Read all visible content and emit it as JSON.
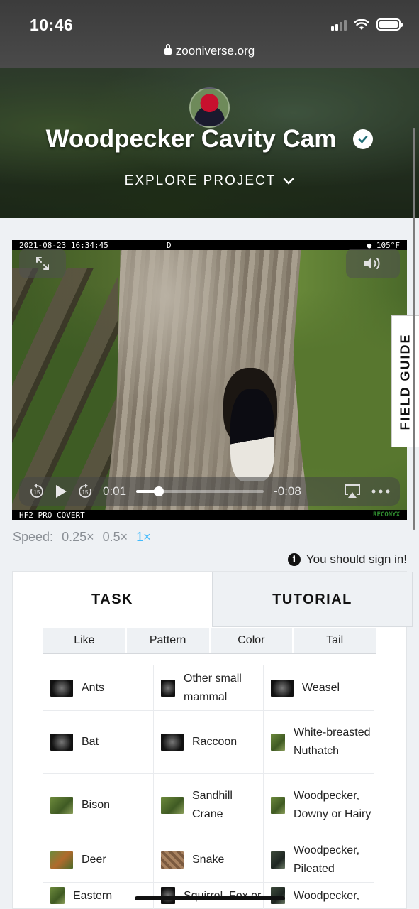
{
  "status_bar": {
    "time": "10:46"
  },
  "browser": {
    "url": "zooniverse.org"
  },
  "project": {
    "title": "Woodpecker Cavity Cam",
    "explore_label": "EXPLORE PROJECT"
  },
  "video": {
    "stamp_left": "2021-08-23 16:34:45",
    "stamp_mid": "D",
    "stamp_right": "● 105°F",
    "stamp_bottom_left": "HF2 PRO COVERT",
    "stamp_bottom_right": "RECONYX",
    "current_time": "0:01",
    "remaining_time": "-0:08",
    "progress_fraction": 0.18
  },
  "field_guide_label": "FIELD GUIDE",
  "speed": {
    "label": "Speed:",
    "options": [
      "0.25×",
      "0.5×",
      "1×"
    ],
    "selected": "1×"
  },
  "signin_notice": "You should sign in!",
  "tabs": {
    "task": "TASK",
    "tutorial": "TUTORIAL"
  },
  "filters": [
    "Like",
    "Pattern",
    "Color",
    "Tail"
  ],
  "choices": [
    [
      "Ants",
      "Other small mammal",
      "Weasel"
    ],
    [
      "Bat",
      "Raccoon",
      "White-breasted Nuthatch"
    ],
    [
      "Bison",
      "Sandhill Crane",
      "Woodpecker, Downy or Hairy"
    ],
    [
      "Deer",
      "Snake",
      "Woodpecker, Pileated"
    ],
    [
      "Eastern Bluebird",
      "Squirrel, Fox or Gray",
      "Woodpecker, Red-bellied"
    ]
  ]
}
